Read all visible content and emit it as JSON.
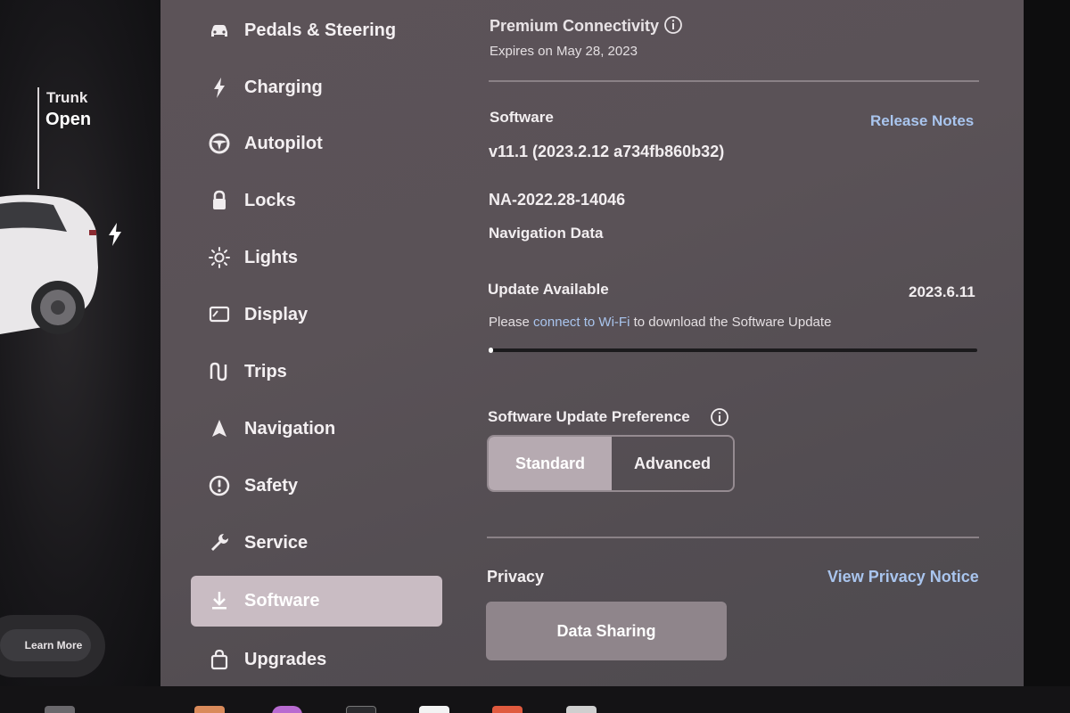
{
  "car": {
    "trunk_label": "Trunk",
    "trunk_status": "Open",
    "learn_more": "Learn More"
  },
  "sidebar": {
    "items": [
      {
        "label": "Pedals & Steering",
        "icon": "car-icon"
      },
      {
        "label": "Charging",
        "icon": "bolt-icon"
      },
      {
        "label": "Autopilot",
        "icon": "steering-wheel-icon"
      },
      {
        "label": "Locks",
        "icon": "lock-icon"
      },
      {
        "label": "Lights",
        "icon": "sun-icon"
      },
      {
        "label": "Display",
        "icon": "display-icon"
      },
      {
        "label": "Trips",
        "icon": "trips-icon"
      },
      {
        "label": "Navigation",
        "icon": "navigation-arrow-icon"
      },
      {
        "label": "Safety",
        "icon": "alert-circle-icon"
      },
      {
        "label": "Service",
        "icon": "wrench-icon"
      },
      {
        "label": "Software",
        "icon": "download-icon",
        "active": true
      },
      {
        "label": "Upgrades",
        "icon": "bag-icon"
      }
    ]
  },
  "connectivity": {
    "title": "Premium Connectivity",
    "expires": "Expires on May 28, 2023"
  },
  "software": {
    "title": "Software",
    "release_notes": "Release Notes",
    "version": "v11.1 (2023.2.12 a734fb860b32)",
    "nav_version": "NA-2022.28-14046",
    "nav_label": "Navigation Data"
  },
  "update": {
    "title": "Update Available",
    "version": "2023.6.11",
    "message_prefix": "Please",
    "message_link": "connect to Wi-Fi",
    "message_suffix": "to download the Software Update",
    "progress": 0.01
  },
  "preference": {
    "title": "Software Update Preference",
    "options": [
      "Standard",
      "Advanced"
    ],
    "selected": "Standard"
  },
  "privacy": {
    "title": "Privacy",
    "notice_link": "View Privacy Notice",
    "data_sharing": "Data Sharing"
  },
  "colors": {
    "accent_link": "#a9c5ee",
    "active_item": "#c9bcc3",
    "screen_bg": "#5a5257"
  }
}
